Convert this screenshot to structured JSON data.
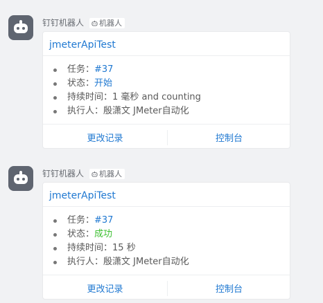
{
  "messages": [
    {
      "sender": "钉钉机器人",
      "badge": "机器人",
      "title": "jmeterApiTest",
      "details": [
        {
          "label": "任务：",
          "value": "#37"
        },
        {
          "label": "状态：",
          "value": "开始"
        },
        {
          "label": "持续时间：",
          "value": "1 毫秒 and counting"
        },
        {
          "label": "执行人：",
          "value": "殷潇文 JMeter自动化"
        }
      ],
      "actions": [
        "更改记录",
        "控制台"
      ]
    },
    {
      "sender": "钉钉机器人",
      "badge": "机器人",
      "title": "jmeterApiTest",
      "details": [
        {
          "label": "任务：",
          "value": "#37"
        },
        {
          "label": "状态：",
          "value": "成功"
        },
        {
          "label": "持续时间：",
          "value": "15 秒"
        },
        {
          "label": "执行人：",
          "value": "殷潇文 JMeter自动化"
        }
      ],
      "actions": [
        "更改记录",
        "控制台"
      ]
    }
  ],
  "icons": {
    "avatar": "robot-avatar-icon",
    "badge": "robot-badge-icon"
  },
  "colors": {
    "link": "#1f78d1",
    "status_start": "#1f78d1",
    "status_success": "#3bbf2f",
    "background": "#f1f2f4",
    "avatar": "#5f6570"
  }
}
